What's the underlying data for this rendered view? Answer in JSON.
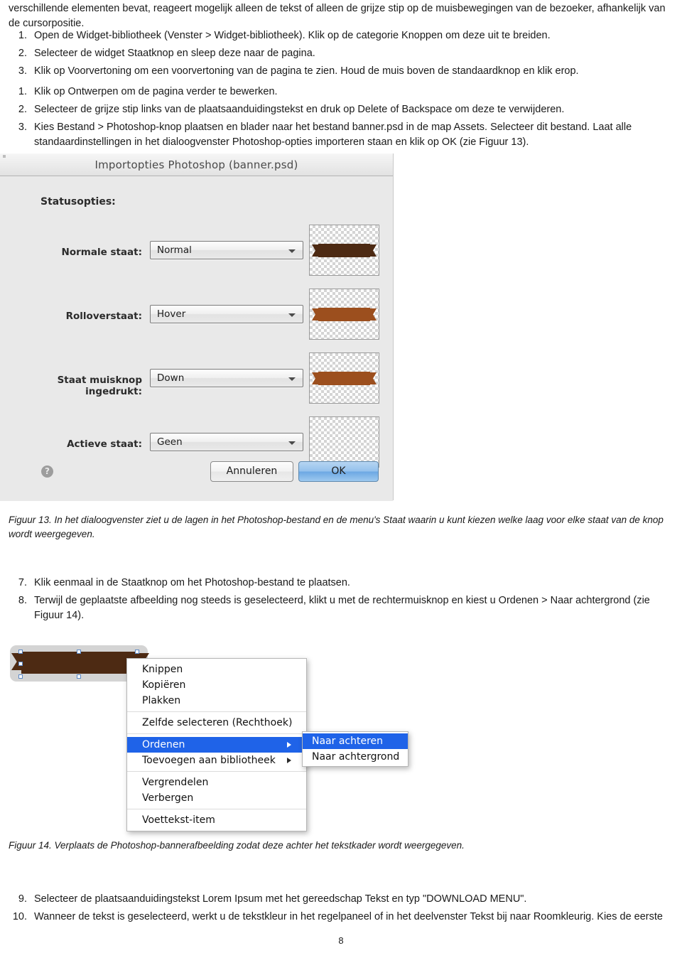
{
  "document": {
    "intro_paragraph": "verschillende elementen bevat, reageert mogelijk alleen de tekst of alleen de grijze stip op de muisbewegingen van de bezoeker, afhankelijk van de cursorpositie.",
    "page_number": "8"
  },
  "list_a": [
    {
      "num": "1.",
      "text": "Open de Widget-bibliotheek (Venster > Widget-bibliotheek). Klik op de categorie Knoppen om deze uit te breiden."
    },
    {
      "num": "2.",
      "text": "Selecteer de widget Staatknop en sleep deze naar de pagina."
    },
    {
      "num": "3.",
      "text": "Klik op Voorvertoning om een voorvertoning van de pagina te zien. Houd de muis boven de standaardknop en klik erop."
    }
  ],
  "list_b": [
    {
      "num": "1.",
      "text": "Klik op Ontwerpen om de pagina verder te bewerken."
    },
    {
      "num": "2.",
      "text": "Selecteer de grijze stip links van de plaatsaanduidingstekst en druk op Delete of Backspace om deze te verwijderen."
    },
    {
      "num": "3.",
      "text": "Kies Bestand > Photoshop-knop plaatsen en blader naar het bestand banner.psd in de map Assets. Selecteer dit bestand. Laat alle standaardinstellingen in het dialoogvenster Photoshop-opties importeren staan en klik op OK (zie Figuur 13)."
    }
  ],
  "list_c": [
    {
      "num": "7.",
      "text": "Klik eenmaal in de Staatknop om het Photoshop-bestand te plaatsen."
    },
    {
      "num": "8.",
      "text": "Terwijl de geplaatste afbeelding nog steeds is geselecteerd, klikt u met de rechtermuisknop en kiest u Ordenen > Naar achtergrond (zie Figuur 14)."
    }
  ],
  "list_d": [
    {
      "num": "9.",
      "text": "Selecteer de plaatsaanduidingstekst Lorem Ipsum met het gereedschap Tekst en typ \"DOWNLOAD MENU\"."
    },
    {
      "num": "10.",
      "text": "Wanneer de tekst is geselecteerd, werkt u de tekstkleur in het regelpaneel of in het deelvenster Tekst bij naar Roomkleurig. Kies de eerste"
    }
  ],
  "captions": {
    "figuur_13": "Figuur 13. In het dialoogvenster ziet u de lagen in het Photoshop-bestand en de menu's Staat waarin u kunt kiezen welke laag voor elke staat van de knop wordt weergegeven.",
    "figuur_14": "Figuur 14. Verplaats de Photoshop-bannerafbeelding zodat deze achter het tekstkader wordt weergegeven."
  },
  "dialog": {
    "title": "Importopties Photoshop (banner.psd)",
    "section_label": "Statusopties:",
    "rows": [
      {
        "label": "Normale staat:",
        "value": "Normal",
        "thumb": "ribbon-dark"
      },
      {
        "label": "Rolloverstaat:",
        "value": "Hover",
        "thumb": "ribbon-light"
      },
      {
        "label": "Staat muisknop ingedrukt:",
        "value": "Down",
        "thumb": "ribbon-light"
      },
      {
        "label": "Actieve staat:",
        "value": "Geen",
        "thumb": "empty"
      }
    ],
    "help_glyph": "?",
    "buttons": {
      "cancel": "Annuleren",
      "ok": "OK"
    },
    "colors": {
      "dialog_background": "#e9e9e9",
      "ok_button_accent": "#6ba7e3",
      "ribbon_dark": "#4d2a13",
      "ribbon_light": "#9c4f1e"
    }
  },
  "context_menu": {
    "items": [
      {
        "label": "Knippen",
        "has_submenu": false,
        "selected": false,
        "separator_after": false
      },
      {
        "label": "Kopiëren",
        "has_submenu": false,
        "selected": false,
        "separator_after": false
      },
      {
        "label": "Plakken",
        "has_submenu": false,
        "selected": false,
        "separator_after": true
      },
      {
        "label": "Zelfde selecteren (Rechthoek)",
        "has_submenu": false,
        "selected": false,
        "separator_after": true
      },
      {
        "label": "Ordenen",
        "has_submenu": true,
        "selected": true,
        "separator_after": false
      },
      {
        "label": "Toevoegen aan bibliotheek",
        "has_submenu": true,
        "selected": false,
        "separator_after": true
      },
      {
        "label": "Vergrendelen",
        "has_submenu": false,
        "selected": false,
        "separator_after": false
      },
      {
        "label": "Verbergen",
        "has_submenu": false,
        "selected": false,
        "separator_after": true
      },
      {
        "label": "Voettekst-item",
        "has_submenu": false,
        "selected": false,
        "separator_after": false
      }
    ],
    "submenu": [
      {
        "label": "Naar achteren",
        "selected": true
      },
      {
        "label": "Naar achtergrond",
        "selected": false
      }
    ],
    "highlight_color": "#1f63e8"
  }
}
